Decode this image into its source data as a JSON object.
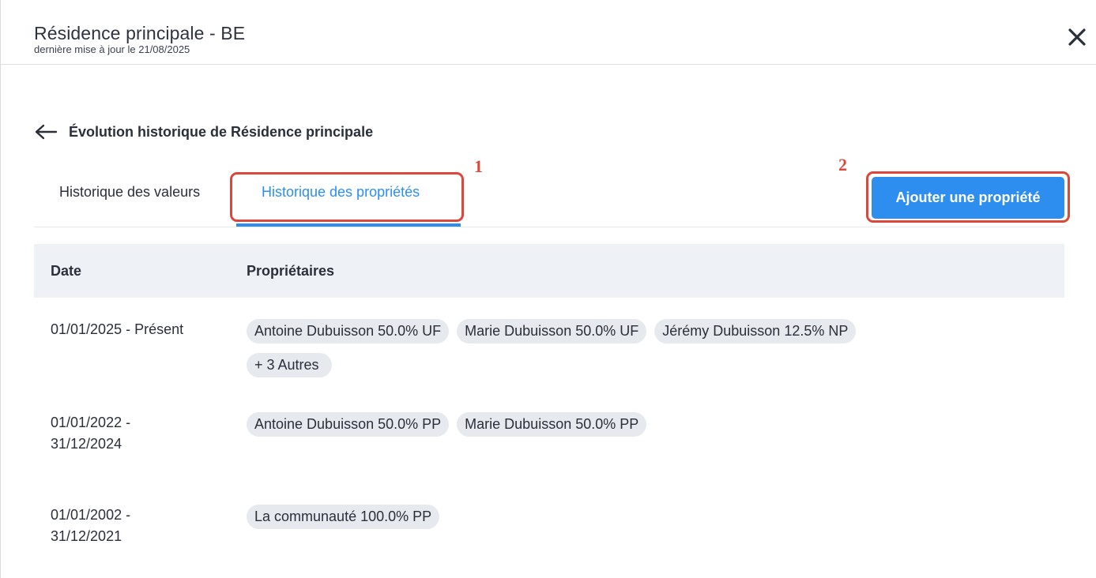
{
  "header": {
    "title": "Résidence principale - BE",
    "subtitle": "dernière mise à jour le 21/08/2025"
  },
  "icons": {
    "close": "close-icon",
    "back": "arrow-left-icon"
  },
  "page_title": "Évolution historique de Résidence principale",
  "tabs": [
    {
      "label": "Historique des valeurs",
      "active": false
    },
    {
      "label": "Historique des propriétés",
      "active": true
    }
  ],
  "annotations": {
    "first": "1",
    "second": "2"
  },
  "add_button_label": "Ajouter une propriété",
  "table": {
    "headers": {
      "date": "Date",
      "owners": "Propriétaires"
    },
    "rows": [
      {
        "date": "01/01/2025 - Présent",
        "owners": [
          "Antoine Dubuisson 50.0% UF",
          "Marie Dubuisson 50.0% UF",
          "Jérémy Dubuisson 12.5% NP"
        ],
        "more": "+ 3 Autres"
      },
      {
        "date": "01/01/2022 - 31/12/2024",
        "owners": [
          "Antoine Dubuisson 50.0% PP",
          "Marie Dubuisson 50.0% PP"
        ]
      },
      {
        "date": "01/01/2002 - 31/12/2021",
        "owners": [
          "La communauté 100.0% PP"
        ]
      }
    ]
  },
  "colors": {
    "accent": "#2d8ef0",
    "annotation": "#d9483b",
    "chip_bg": "#e6e9ee",
    "table_header_bg": "#eef1f5"
  }
}
